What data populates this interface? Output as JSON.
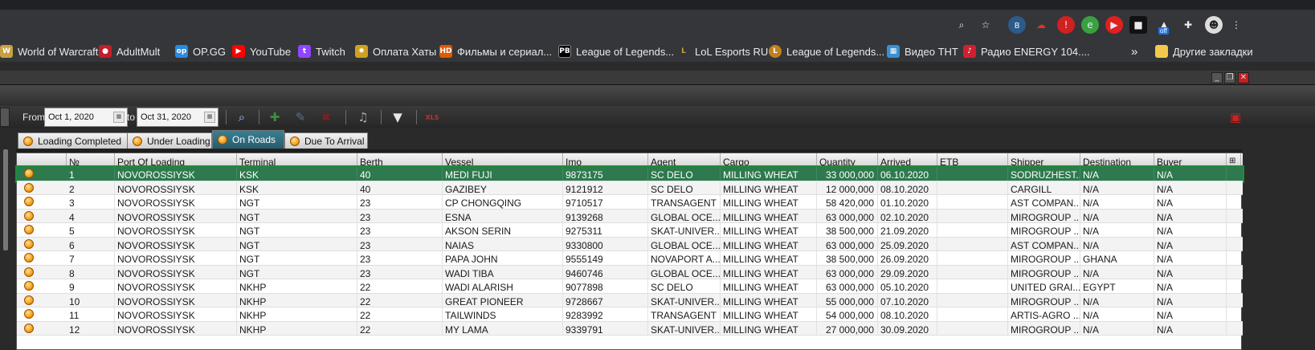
{
  "browser": {
    "bookmarks": [
      {
        "label": "World of Warcraft",
        "icon": "wow-icon",
        "color": "#c8a040"
      },
      {
        "label": "AdultMult",
        "icon": "adultmult-icon",
        "color": "#c0202a"
      },
      {
        "label": "OP.GG",
        "icon": "opgg-icon",
        "color": "#2a8ae0"
      },
      {
        "label": "YouTube",
        "icon": "youtube-icon",
        "color": "#ff0000"
      },
      {
        "label": "Twitch",
        "icon": "twitch-icon",
        "color": "#9146ff"
      },
      {
        "label": "Оплата Хаты",
        "icon": "sun-icon",
        "color": "#d0a020"
      },
      {
        "label": "Фильмы и сериал...",
        "icon": "hd-icon",
        "color": "#e05a00"
      },
      {
        "label": "League of Legends...",
        "icon": "pb-icon",
        "color": "#000000"
      },
      {
        "label": "LoL Esports RU",
        "icon": "lol-esports-icon",
        "color": "#c8a040"
      },
      {
        "label": "League of Legends...",
        "icon": "lol-icon",
        "color": "#c08020"
      },
      {
        "label": "Видео ТНТ",
        "icon": "tnt-icon",
        "color": "#3a8fd0"
      },
      {
        "label": "Радио ENERGY 104....",
        "icon": "radio-icon",
        "color": "#d02030"
      }
    ],
    "overflow_label": "»",
    "other_bookmarks_label": "Другие закладки",
    "extension_badge": "off"
  },
  "filter": {
    "from_label": "From",
    "from_value": "Oct 1, 2020",
    "to_label": "to",
    "to_value": "Oct 31, 2020"
  },
  "tabs": [
    {
      "label": "Loading Completed",
      "active": false
    },
    {
      "label": "Under Loading",
      "active": false
    },
    {
      "label": "On Roads",
      "active": true
    },
    {
      "label": "Due To Arrival",
      "active": false
    }
  ],
  "table": {
    "columns": [
      "",
      "№",
      "Port Of Loading",
      "Terminal",
      "Berth",
      "Vessel",
      "Imo",
      "Agent",
      "Cargo",
      "Quantity",
      "Arrived",
      "ETB",
      "Shipper",
      "Destination",
      "Buyer"
    ],
    "rows": [
      [
        "",
        "1",
        "NOVOROSSIYSK",
        "KSK",
        "40",
        "MEDI FUJI",
        "9873175",
        "SC DELO",
        "MILLING WHEAT",
        "33 000,000",
        "06.10.2020",
        "",
        "SODRUZHEST...",
        "N/A",
        "N/A"
      ],
      [
        "",
        "2",
        "NOVOROSSIYSK",
        "KSK",
        "40",
        "GAZIBEY",
        "9121912",
        "SC DELO",
        "MILLING WHEAT",
        "12 000,000",
        "08.10.2020",
        "",
        "CARGILL",
        "N/A",
        "N/A"
      ],
      [
        "",
        "3",
        "NOVOROSSIYSK",
        "NGT",
        "23",
        "CP CHONGQING",
        "9710517",
        "TRANSAGENT",
        "MILLING WHEAT",
        "58 420,000",
        "01.10.2020",
        "",
        "AST COMPAN...",
        "N/A",
        "N/A"
      ],
      [
        "",
        "4",
        "NOVOROSSIYSK",
        "NGT",
        "23",
        "ESNA",
        "9139268",
        "GLOBAL OCE...",
        "MILLING WHEAT",
        "63 000,000",
        "02.10.2020",
        "",
        "MIROGROUP ...",
        "N/A",
        "N/A"
      ],
      [
        "",
        "5",
        "NOVOROSSIYSK",
        "NGT",
        "23",
        "AKSON SERIN",
        "9275311",
        "SKAT-UNIVER...",
        "MILLING WHEAT",
        "38 500,000",
        "21.09.2020",
        "",
        "MIROGROUP ...",
        "N/A",
        "N/A"
      ],
      [
        "",
        "6",
        "NOVOROSSIYSK",
        "NGT",
        "23",
        "NAIAS",
        "9330800",
        "GLOBAL OCE...",
        "MILLING WHEAT",
        "63 000,000",
        "25.09.2020",
        "",
        "AST COMPAN...",
        "N/A",
        "N/A"
      ],
      [
        "",
        "7",
        "NOVOROSSIYSK",
        "NGT",
        "23",
        "PAPA JOHN",
        "9555149",
        "NOVAPORT A...",
        "MILLING WHEAT",
        "38 500,000",
        "26.09.2020",
        "",
        "MIROGROUP ...",
        "GHANA",
        "N/A"
      ],
      [
        "",
        "8",
        "NOVOROSSIYSK",
        "NGT",
        "23",
        "WADI TIBA",
        "9460746",
        "GLOBAL OCE...",
        "MILLING WHEAT",
        "63 000,000",
        "29.09.2020",
        "",
        "MIROGROUP ...",
        "N/A",
        "N/A"
      ],
      [
        "",
        "9",
        "NOVOROSSIYSK",
        "NKHP",
        "22",
        "WADI ALARISH",
        "9077898",
        "SC DELO",
        "MILLING WHEAT",
        "63 000,000",
        "05.10.2020",
        "",
        "UNITED GRAI...",
        "EGYPT",
        "N/A"
      ],
      [
        "",
        "10",
        "NOVOROSSIYSK",
        "NKHP",
        "22",
        "GREAT PIONEER",
        "9728667",
        "SKAT-UNIVER...",
        "MILLING WHEAT",
        "55 000,000",
        "07.10.2020",
        "",
        "MIROGROUP ...",
        "N/A",
        "N/A"
      ],
      [
        "",
        "11",
        "NOVOROSSIYSK",
        "NKHP",
        "22",
        "TAILWINDS",
        "9283992",
        "TRANSAGENT",
        "MILLING WHEAT",
        "54 000,000",
        "08.10.2020",
        "",
        "ARTIS-AGRO ...",
        "N/A",
        "N/A"
      ],
      [
        "",
        "12",
        "NOVOROSSIYSK",
        "NKHP",
        "22",
        "MY LAMA",
        "9339791",
        "SKAT-UNIVER...",
        "MILLING WHEAT",
        "27 000,000",
        "30.09.2020",
        "",
        "MIROGROUP ...",
        "N/A",
        "N/A"
      ]
    ],
    "selected_row": 0
  }
}
